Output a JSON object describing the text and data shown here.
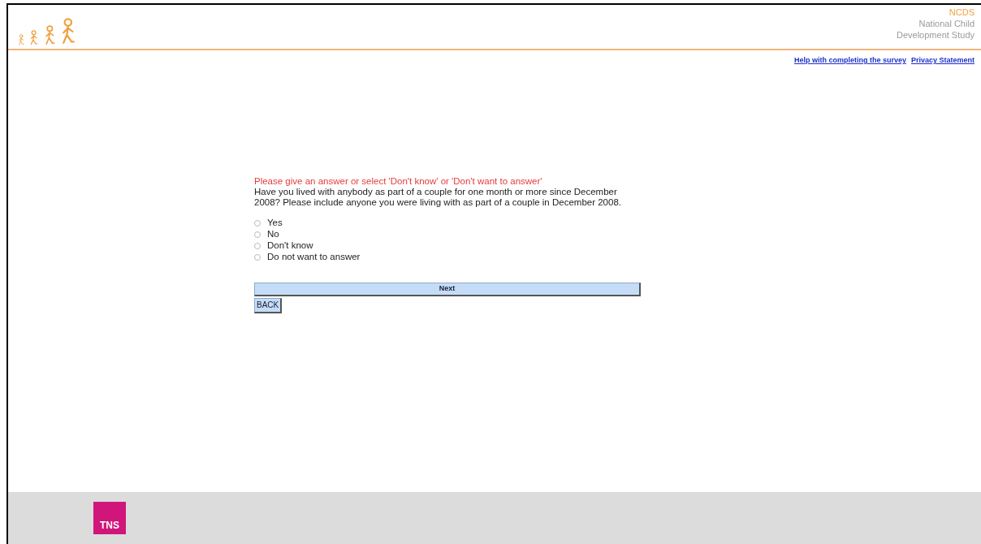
{
  "header": {
    "logo_lines": [
      "NCDS",
      "National Child",
      "Development Study"
    ]
  },
  "links": [
    "Help with completing the survey",
    "Privacy Statement"
  ],
  "question": {
    "error": "Please give an answer or select 'Don't know' or 'Don't want to answer'",
    "text": "Have you lived with anybody as part of a couple for one month or more since December 2008? Please include anyone you were living with as part of a couple in December 2008.",
    "options": [
      {
        "label": "Yes",
        "selected": false
      },
      {
        "label": "No",
        "selected": false
      },
      {
        "label": "Don't know",
        "selected": false
      },
      {
        "label": "Do not want to answer",
        "selected": false
      }
    ]
  },
  "buttons": {
    "next": "Next",
    "back": "BACK"
  },
  "footer": {
    "badge": "TNS"
  }
}
